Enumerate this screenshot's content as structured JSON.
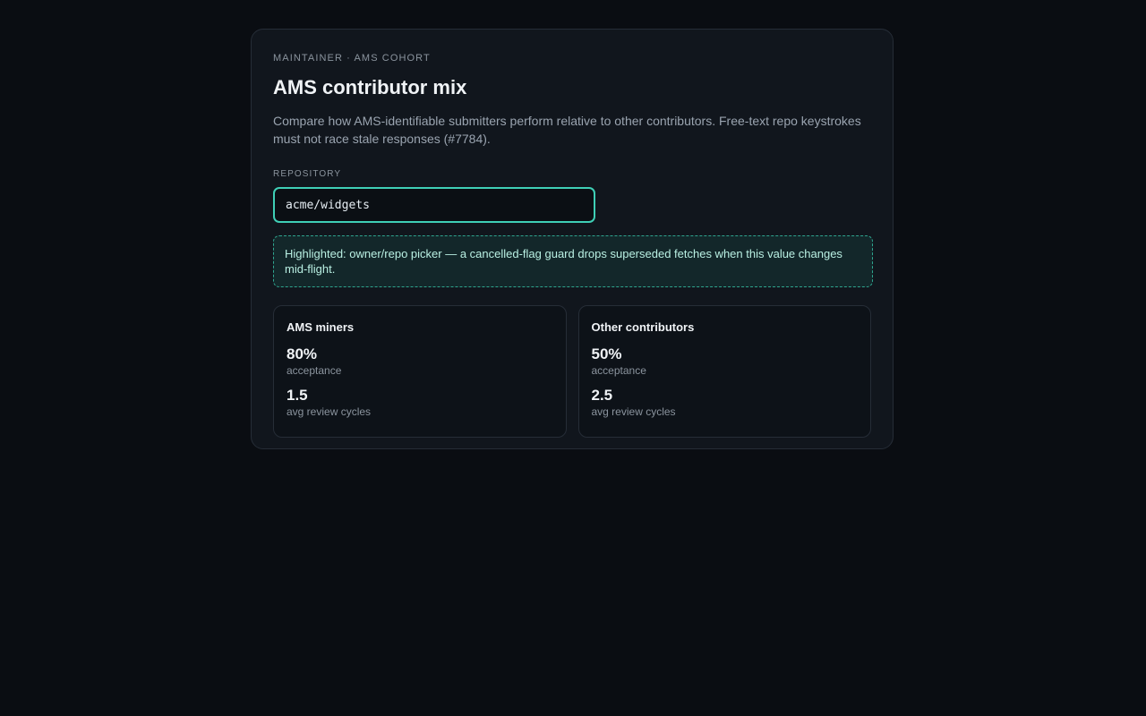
{
  "header": {
    "eyebrow": "MAINTAINER · AMS COHORT",
    "title": "AMS contributor mix",
    "description": "Compare how AMS-identifiable submitters perform relative to other contributors. Free-text repo keystrokes must not race stale responses (#7784)."
  },
  "repository": {
    "label": "REPOSITORY",
    "value": "acme/widgets",
    "placeholder": ""
  },
  "callout": {
    "text": "Highlighted: owner/repo picker — a cancelled-flag guard drops superseded fetches when this value changes mid-flight."
  },
  "cohorts": [
    {
      "name": "AMS miners",
      "acceptance_value": "80%",
      "acceptance_label": "acceptance",
      "review_value": "1.5",
      "review_label": "avg review cycles"
    },
    {
      "name": "Other contributors",
      "acceptance_value": "50%",
      "acceptance_label": "acceptance",
      "review_value": "2.5",
      "review_label": "avg review cycles"
    }
  ],
  "colors": {
    "accent": "#3fcfb6",
    "background": "#0a0d12",
    "card": "#11161d"
  }
}
